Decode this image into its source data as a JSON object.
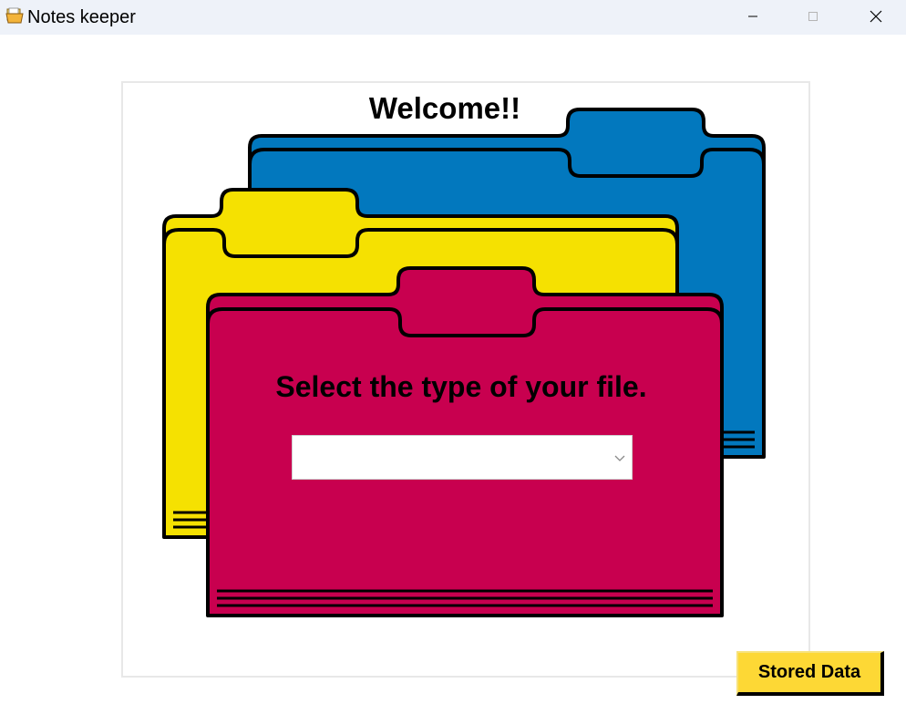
{
  "window": {
    "title": "Notes keeper",
    "icon": "folder-icon",
    "controls": [
      "minimize-icon",
      "maximize-icon",
      "close-icon"
    ]
  },
  "main": {
    "welcome": "Welcome!!",
    "prompt": "Select the type of your file.",
    "file_type_select": {
      "value": "",
      "icon": "chevron-down-icon"
    },
    "stored_data_button": "Stored Data"
  },
  "colors": {
    "blue_folder": "#0278be",
    "yellow_folder": "#f5e101",
    "red_folder": "#c8004f",
    "button": "#fdd835",
    "titlebar": "#eef2f9"
  }
}
